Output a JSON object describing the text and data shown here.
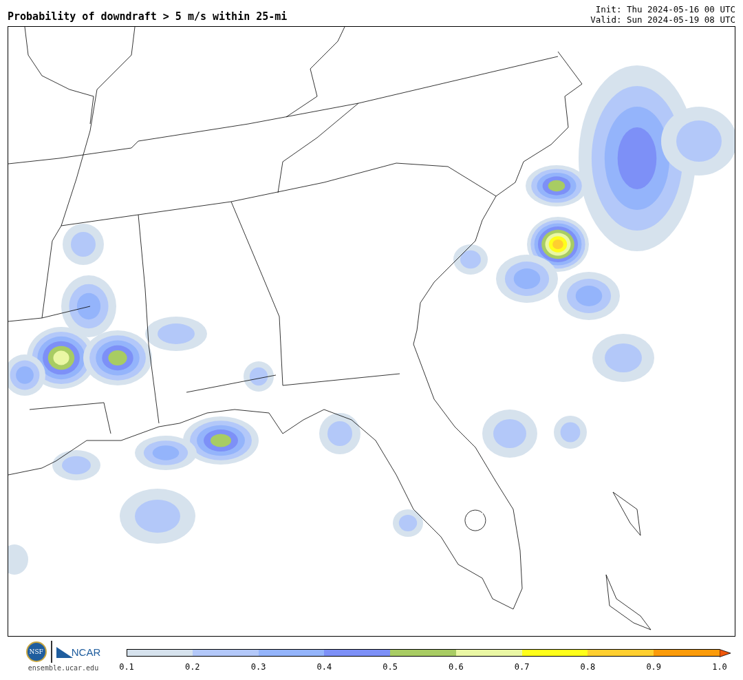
{
  "header": {
    "title": "Probability of downdraft > 5 m/s within 25-mi",
    "init": "Init: Thu 2024-05-16 00 UTC",
    "valid": "Valid: Sun 2024-05-19 08 UTC"
  },
  "footer": {
    "nsf_logo": "NSF",
    "ncar_logo": "NCAR",
    "url": "ensemble.ucar.edu",
    "colorbar": {
      "bins": [
        {
          "kind": "bar",
          "color": "#d6e2ed"
        },
        {
          "kind": "bar",
          "color": "#b3c8f9"
        },
        {
          "kind": "bar",
          "color": "#94b4fb"
        },
        {
          "kind": "bar",
          "color": "#7d90f7"
        },
        {
          "kind": "bar",
          "color": "#a8cc63"
        },
        {
          "kind": "bar",
          "color": "#eaf7a4"
        },
        {
          "kind": "bar",
          "color": "#ffff1a"
        },
        {
          "kind": "bar",
          "color": "#ffcf2f"
        },
        {
          "kind": "bar",
          "color": "#fb9b0a"
        },
        {
          "kind": "extend",
          "color": "#f0560a"
        }
      ],
      "ticks": [
        "0.1",
        "0.2",
        "0.3",
        "0.4",
        "0.5",
        "0.6",
        "0.7",
        "0.8",
        "0.9",
        "1.0"
      ]
    }
  }
}
